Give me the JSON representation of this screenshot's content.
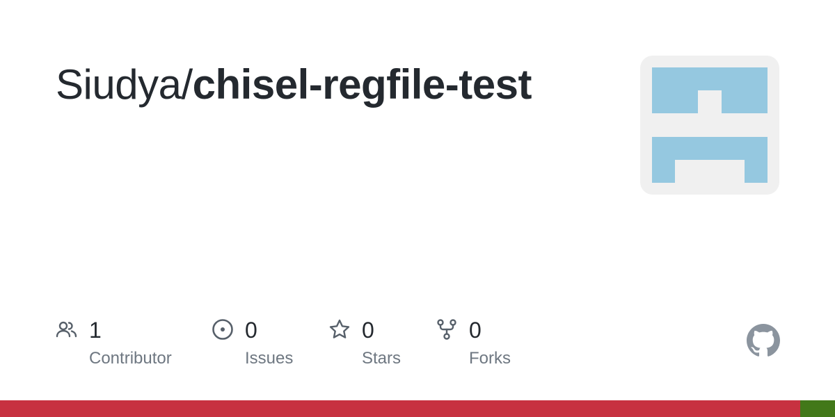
{
  "repo": {
    "owner": "Siudya/",
    "name": "chisel-regfile-test"
  },
  "stats": [
    {
      "icon": "people-icon",
      "count": "1",
      "label": "Contributor"
    },
    {
      "icon": "issue-icon",
      "count": "0",
      "label": "Issues"
    },
    {
      "icon": "star-icon",
      "count": "0",
      "label": "Stars"
    },
    {
      "icon": "fork-icon",
      "count": "0",
      "label": "Forks"
    }
  ],
  "avatar": {
    "background": "#f0f0f0",
    "color": "#95c8e0"
  },
  "colors": {
    "text": "#24292f",
    "muted": "#6e7781",
    "icon": "#57606a",
    "logo": "#8b949e"
  },
  "languages": [
    {
      "color": "#c73140",
      "share": 0.958
    },
    {
      "color": "#427819",
      "share": 0.042
    }
  ]
}
